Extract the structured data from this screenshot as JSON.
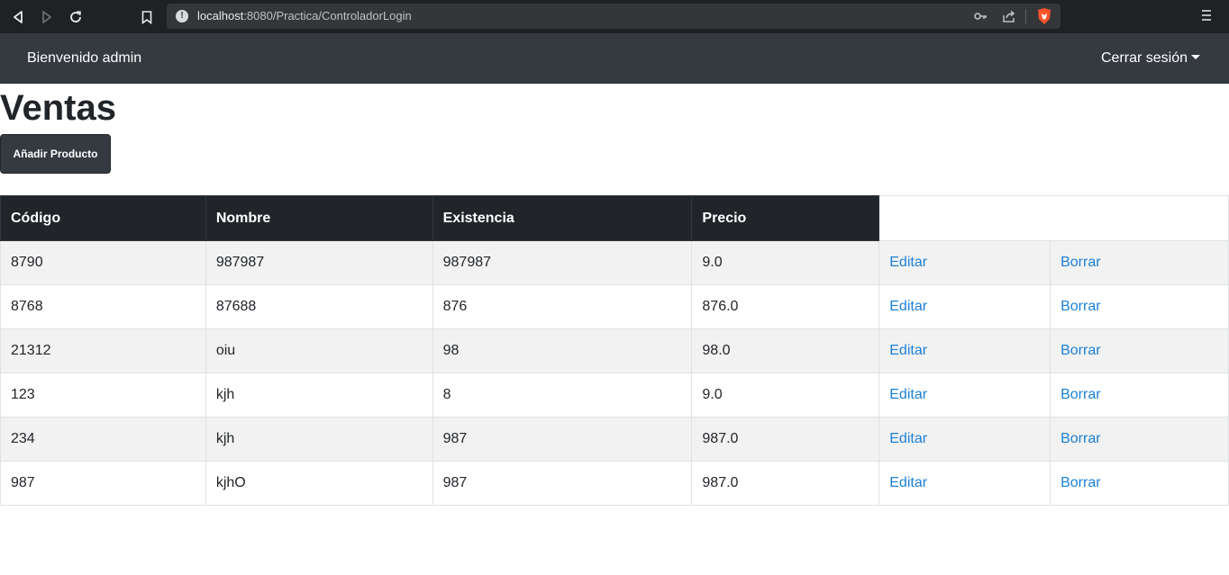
{
  "browser": {
    "url_host": "localhost",
    "url_rest": ":8080/Practica/ControladorLogin"
  },
  "navbar": {
    "welcome": "Bienvenido admin",
    "logout": "Cerrar sesión"
  },
  "main": {
    "title": "Ventas",
    "add_button": "Añadir Producto"
  },
  "table": {
    "headers": [
      "Código",
      "Nombre",
      "Existencia",
      "Precio"
    ],
    "edit_label": "Editar",
    "delete_label": "Borrar",
    "rows": [
      {
        "codigo": "8790",
        "nombre": "987987",
        "existencia": "987987",
        "precio": "9.0"
      },
      {
        "codigo": "8768",
        "nombre": "87688",
        "existencia": "876",
        "precio": "876.0"
      },
      {
        "codigo": "21312",
        "nombre": "oiu",
        "existencia": "98",
        "precio": "98.0"
      },
      {
        "codigo": "123",
        "nombre": "kjh",
        "existencia": "8",
        "precio": "9.0"
      },
      {
        "codigo": "234",
        "nombre": "kjh",
        "existencia": "987",
        "precio": "987.0"
      },
      {
        "codigo": "987",
        "nombre": "kjhO",
        "existencia": "987",
        "precio": "987.0"
      }
    ]
  },
  "colors": {
    "navbar_bg": "#343a40",
    "table_head_bg": "#212529",
    "link": "#1b7fd6",
    "brave_orange": "#fb542b"
  }
}
